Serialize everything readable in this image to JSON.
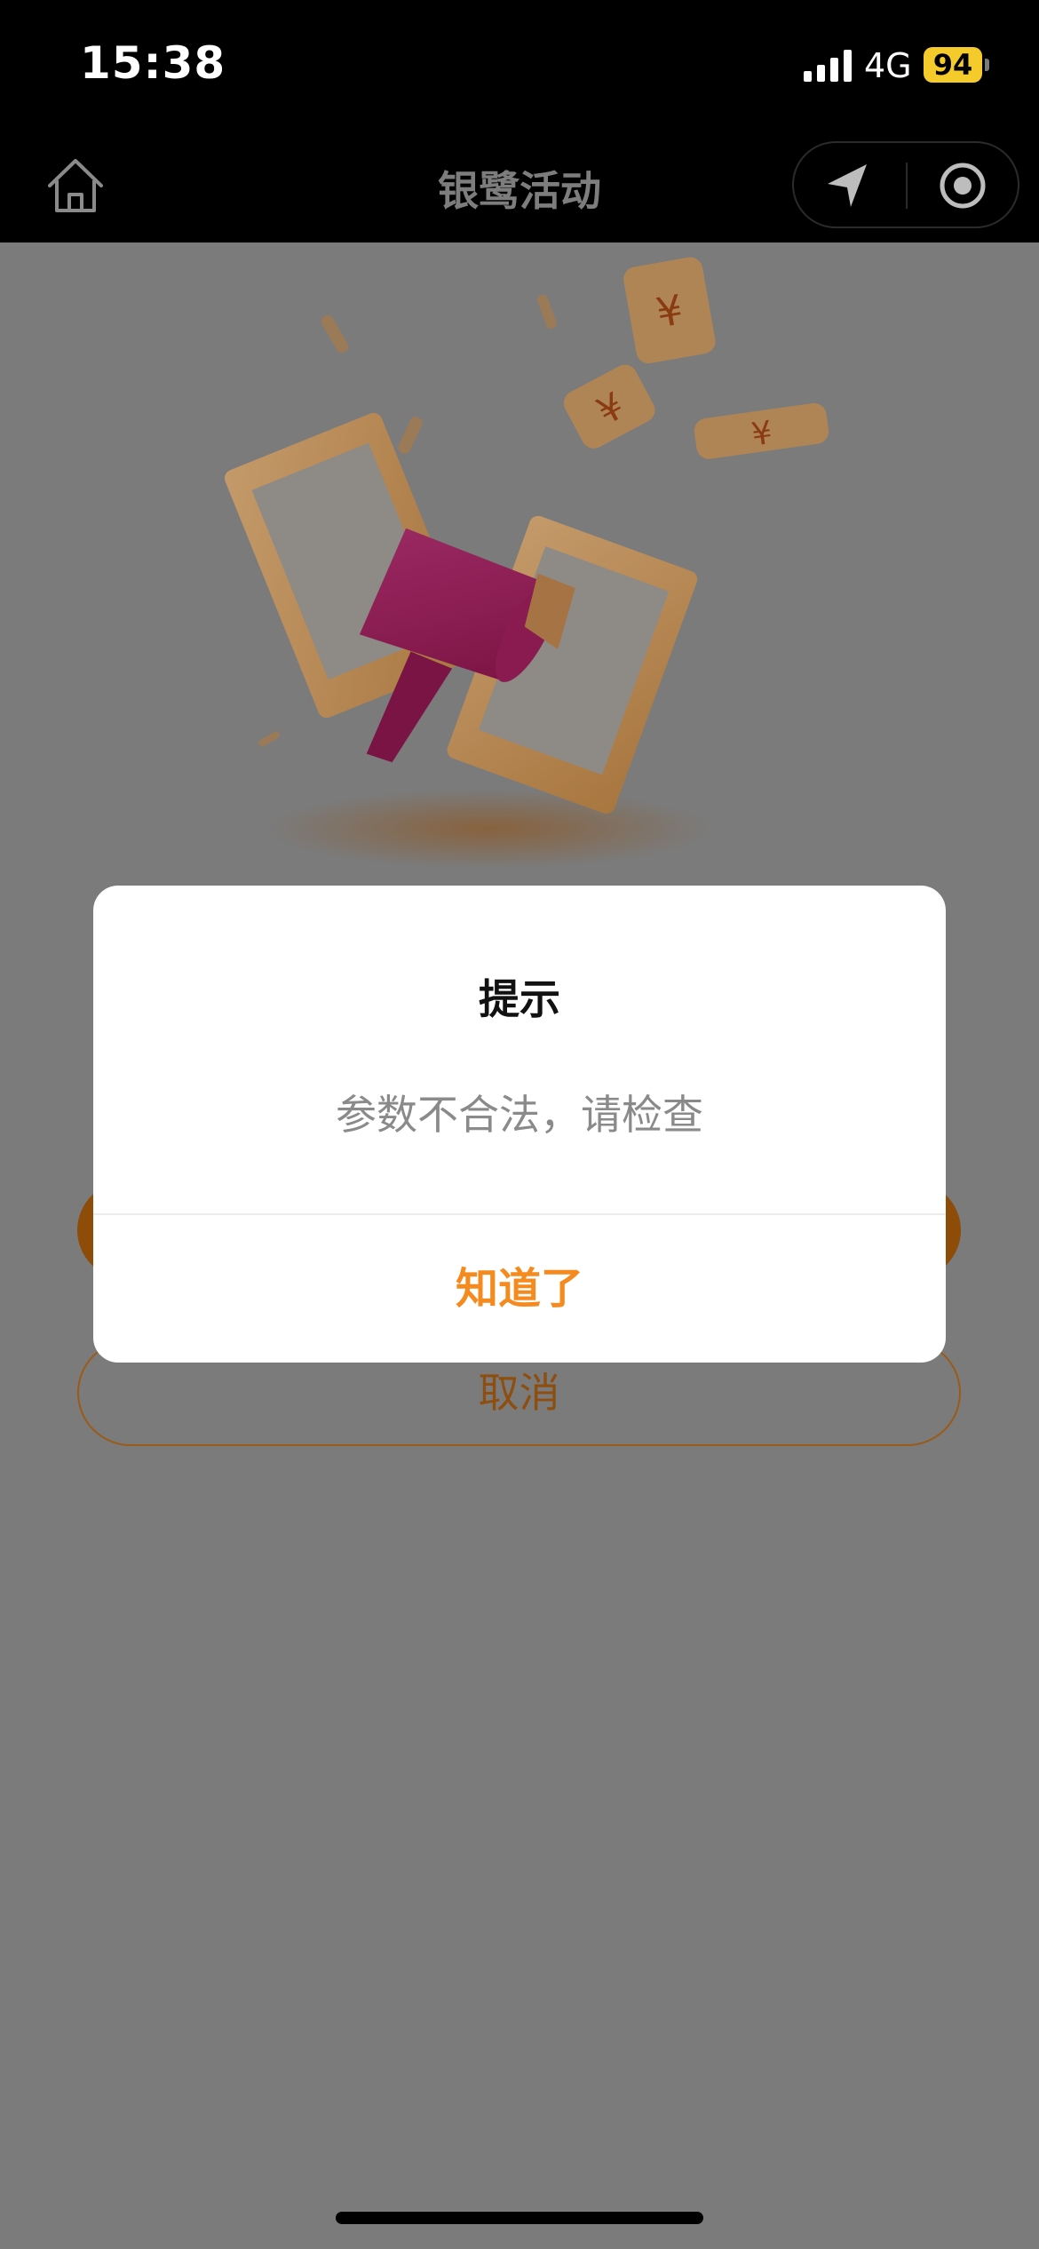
{
  "status_bar": {
    "time": "15:38",
    "network": "4G",
    "battery": "94"
  },
  "nav": {
    "title": "银鹭活动"
  },
  "buttons": {
    "cancel_label": "取消"
  },
  "modal": {
    "title": "提示",
    "message": "参数不合法，请检查",
    "confirm_label": "知道了"
  },
  "icons": {
    "home": "home-icon",
    "location": "location-arrow-icon",
    "record": "record-icon",
    "currency": "yuan-icon"
  },
  "colors": {
    "accent": "#f58b1f",
    "overlay": "#7b7b7b",
    "battery": "#f5cb2c"
  }
}
